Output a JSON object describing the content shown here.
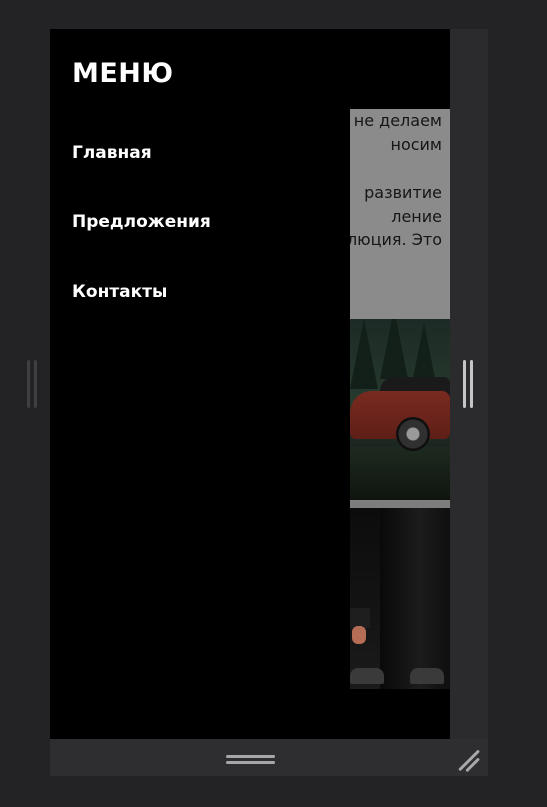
{
  "menu": {
    "title": "МЕНЮ",
    "items": [
      {
        "label": "Главная"
      },
      {
        "label": "Предложения"
      },
      {
        "label": "Контакты"
      }
    ]
  },
  "page_text": {
    "paragraph_1": "а не делаем\nносим",
    "paragraph_2": "развитие\nление\nлюция. Это"
  },
  "colors": {
    "stage_background": "#232325",
    "frame_background": "#2b2b2e",
    "menu_background": "#000000",
    "menu_text": "#ffffff",
    "text_block_background": "#8b8b8b",
    "handle_color": "#a7a7a9"
  },
  "icons": {
    "bottom_handle": "double-horizontal-line",
    "corner_handle": "diagonal-resize-lines",
    "side_handle": "double-vertical-line"
  }
}
